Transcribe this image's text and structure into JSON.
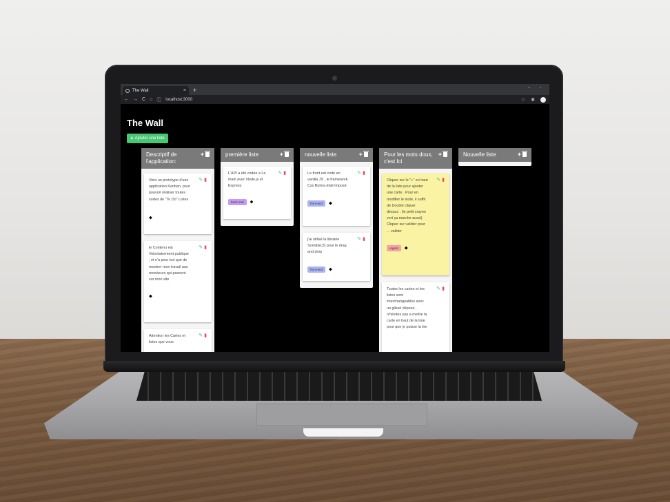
{
  "browser": {
    "tab_title": "The Wall",
    "tab_close": "×",
    "new_tab": "+",
    "window_controls": "– ▫",
    "url": "localhost:3000",
    "nav": [
      "←",
      "→",
      "C",
      "⌂",
      "ⓘ"
    ],
    "right_icons": [
      "☆",
      "✱"
    ]
  },
  "app": {
    "title": "The Wall",
    "add_list_label": "Ajouter une liste",
    "add_list_plus": "+"
  },
  "lists": [
    {
      "title": "Descriptif de l'application:",
      "cards": [
        {
          "text": "Voici un prototype d'une application Kanban, pour pouvoir réaliser toutes sortes de \"To Do\" Listes",
          "tag": null
        },
        {
          "text": "le Contenu est Volontairement publique , et n'a pour but que de montrer mon travail aux recruteurs qui passent sur mon site",
          "tag": null
        },
        {
          "text": "Attention les Cartes et listes que vous",
          "tag": null
        }
      ]
    },
    {
      "title": "première liste",
      "cards": [
        {
          "text": "L'API a été codée a La main avec Node.js et Express",
          "tag": "back-end"
        }
      ]
    },
    {
      "title": "nouvelle liste",
      "cards": [
        {
          "text": "Le front est codé en vanilla JS , le framework Css Bulma était imposé.",
          "tag": "front-end"
        },
        {
          "text": "j'ai utilisé la librairie SortableJS pour le drag and drop",
          "tag": "front-end"
        }
      ]
    },
    {
      "title": "Pour les mots doux, c'est Ici",
      "cards": [
        {
          "text": "Cliquer sur le \"+\" en haut de la liste pour ajouter une carte . Pour en modifier le texte, il suffit de Double cliquer dessus . (le petit crayon vert ça marche aussi) Cliquer sur valider pour ... valider",
          "tag": "urgent",
          "yellow": true
        },
        {
          "text": "Toutes les cartes et les listes sont interchangeables avec un glissé déposé , n'hésites pas a mettre ta carte en haut de la liste pour que je puisse la lire",
          "tag": null
        }
      ]
    },
    {
      "title": "Nouvelle liste",
      "cards": []
    }
  ],
  "icons": {
    "list_add": "plus-icon",
    "list_delete": "trash-icon",
    "card_edit": "pencil-icon",
    "card_delete": "trash-icon",
    "tags": "tags-icon"
  },
  "colors": {
    "add_button": "#48c774",
    "list_header": "#7a7a7a",
    "tag_back_end": "#c49bf2",
    "tag_front_end": "#aab4f5",
    "tag_urgent": "#f6a2a2",
    "card_yellow": "#f9f3a3"
  }
}
